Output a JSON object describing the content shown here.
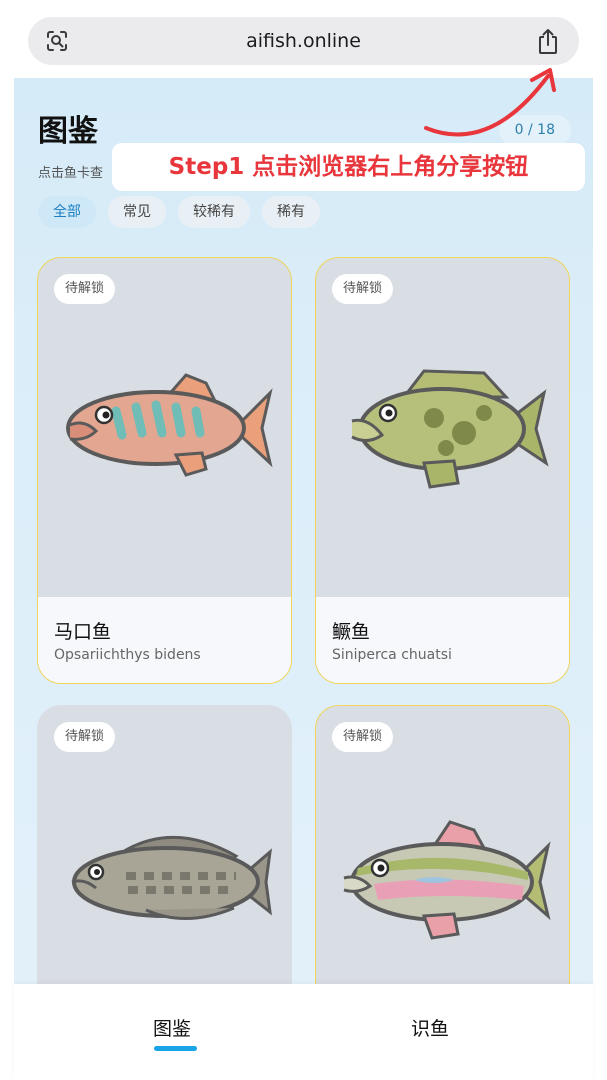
{
  "browser": {
    "url": "aifish.online",
    "lens_icon": "visual-search-icon",
    "share_icon": "share-icon"
  },
  "page": {
    "title": "图鉴",
    "subtitle": "点击鱼卡查",
    "counter": "0 / 18",
    "filters": [
      {
        "label": "全部",
        "active": true
      },
      {
        "label": "常见",
        "active": false
      },
      {
        "label": "较稀有",
        "active": false
      },
      {
        "label": "稀有",
        "active": false
      }
    ]
  },
  "cards": [
    {
      "badge": "待解锁",
      "name_cn": "马口鱼",
      "name_latin": "Opsariichthys bidens"
    },
    {
      "badge": "待解锁",
      "name_cn": "鳜鱼",
      "name_latin": "Siniperca chuatsi"
    },
    {
      "badge": "待解锁",
      "name_cn": "",
      "name_latin": ""
    },
    {
      "badge": "待解锁",
      "name_cn": "",
      "name_latin": ""
    }
  ],
  "tabs": [
    {
      "label": "图鉴",
      "active": true
    },
    {
      "label": "识鱼",
      "active": false
    }
  ],
  "annotation": {
    "text": "Step1  点击浏览器右上角分享按钮",
    "color": "#e8363c"
  }
}
